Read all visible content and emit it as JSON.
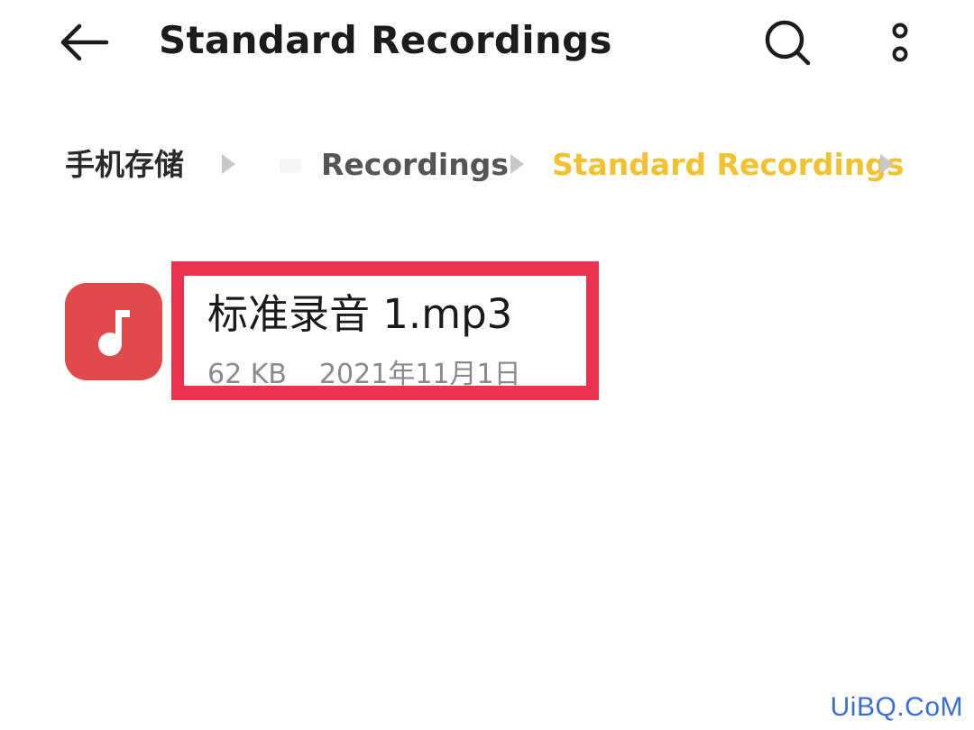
{
  "header": {
    "title": "Standard Recordings",
    "back_icon": "arrow-left-icon",
    "search_icon": "search-icon",
    "more_icon": "more-vertical-icon"
  },
  "breadcrumb": {
    "root": "手机存储",
    "level1": "Recordings",
    "current": "Standard Recordings",
    "current_color": "#f2c12e"
  },
  "file": {
    "name": "标准录音 1.mp3",
    "size": "62 KB",
    "date": "2021年11月1日",
    "icon": "music-note-icon",
    "icon_color": "#e04a4d",
    "highlight_color": "#e9334f"
  },
  "watermark": "UiBQ.CoM"
}
